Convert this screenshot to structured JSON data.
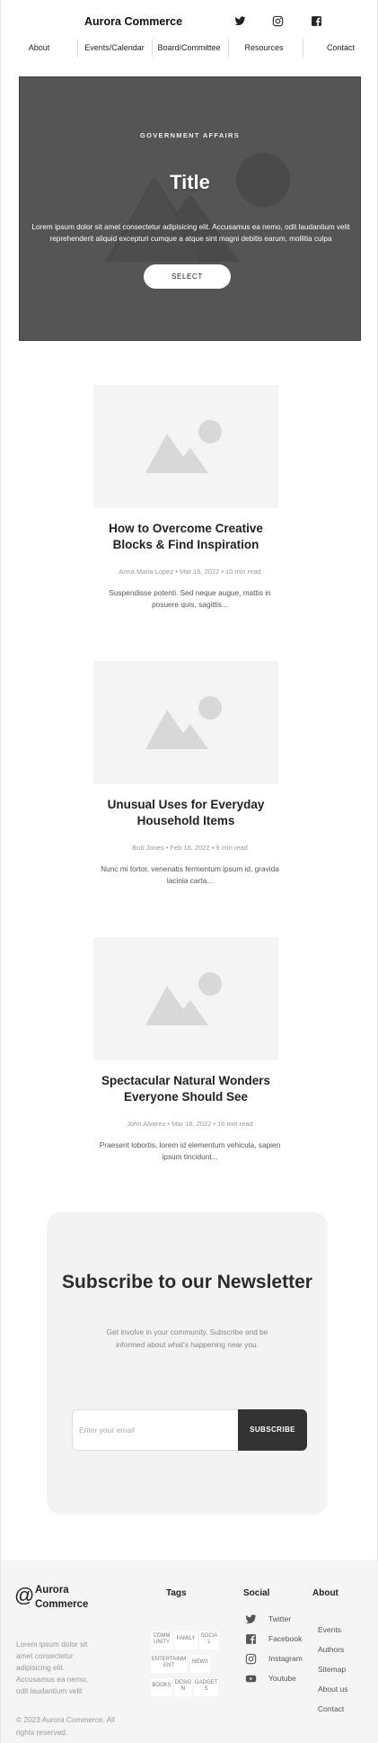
{
  "header": {
    "brand": "Aurora Commerce",
    "social_icons": [
      "twitter-icon",
      "instagram-icon",
      "facebook-icon"
    ]
  },
  "nav": {
    "items": [
      "About",
      "Events/Calendar",
      "Board/Committee",
      "Resources",
      "Contact"
    ]
  },
  "hero": {
    "eyebrow": "GOVERNMENT AFFAIRS",
    "title": "Title",
    "description": "Lorem ipsum dolor sit amet consectetur adipisicing elit. Accusamus ea nemo, odit laudantium velit reprehenderit aliquid excepturi cumque a atque sint magni debitis earum, mollitia culpa",
    "button": "SELECT",
    "background": "#555555"
  },
  "posts": [
    {
      "title": "How to Overcome Creative Blocks & Find Inspiration",
      "author": "Anna Maria Lopez",
      "date": "Mar 15, 2022",
      "read_time": "10 min read",
      "excerpt": "Suspendisse potenti. Sed neque augue, mattis in posuere quis, sagittis..."
    },
    {
      "title": "Unusual Uses for Everyday Household Items",
      "author": "Bob Jones",
      "date": "Feb 18, 2022",
      "read_time": "9 min read",
      "excerpt": "Nunc mi tortor, venenatis fermentum ipsum id, gravida lacinia carta..."
    },
    {
      "title": "Spectacular Natural Wonders Everyone Should See",
      "author": "John Alvarez",
      "date": "Mar 18, 2022",
      "read_time": "16 min read",
      "excerpt": "Praesent lobortis, lorem id elementum vehicula, sapien ipsum tincidunt..."
    }
  ],
  "newsletter": {
    "title": "Subscribe to our Newsletter",
    "description": "Get involve in your community. Subscribe and be informed about what's happening near you.",
    "email_placeholder": "Enter your email",
    "button": "SUBSCRIBE"
  },
  "footer": {
    "brand": "Aurora Commerce",
    "description": "Lorem ipsum dolor sit amet consectetur adipisicing elit. Accusamus ea nemo, odit laudantium velit",
    "copyright": "© 2023 Aurora Commerce.  All rights reserved.",
    "tags_heading": "Tags",
    "tags": [
      "COMM UNITY",
      "FAMILY",
      "SOCIA L",
      "ENTERTAINM ENT",
      "NEWS",
      "BOOKS",
      "DESIG N",
      "GADGET S"
    ],
    "social_heading": "Social",
    "social": [
      {
        "label": "Twitter",
        "icon": "twitter-icon"
      },
      {
        "label": "Facebook",
        "icon": "facebook-icon"
      },
      {
        "label": "Instagram",
        "icon": "instagram-icon"
      },
      {
        "label": "Youtube",
        "icon": "youtube-icon"
      }
    ],
    "about_heading": "About",
    "about_links": [
      "Events",
      "Authors",
      "Sitemap",
      "About us",
      "Contact"
    ]
  }
}
